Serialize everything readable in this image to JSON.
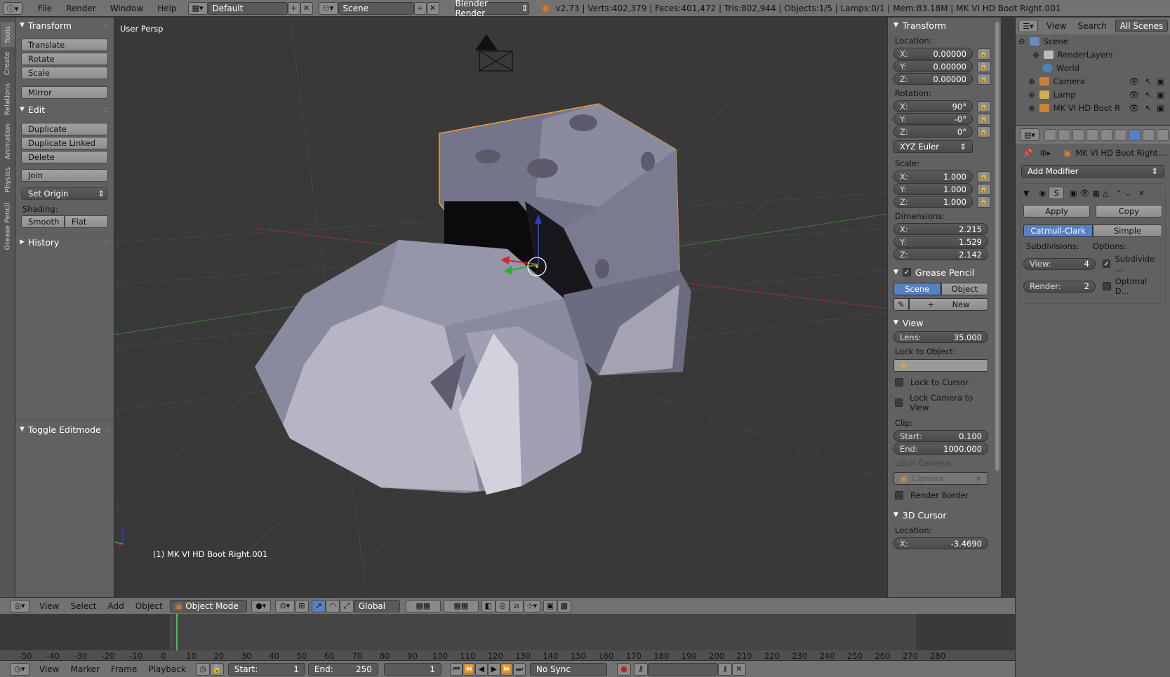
{
  "topbar": {
    "menus": [
      "File",
      "Render",
      "Window",
      "Help"
    ],
    "layout": "Default",
    "scene": "Scene",
    "engine": "Blender Render",
    "status": "v2.73 | Verts:402,379 | Faces:401,472 | Tris:802,944 | Objects:1/5 | Lamps:0/1 | Mem:83.18M | MK VI HD Boot Right.001"
  },
  "tabs": [
    "Tools",
    "Create",
    "Relations",
    "Animation",
    "Physics",
    "Grease Pencil"
  ],
  "toolshelf": {
    "transform_title": "Transform",
    "translate": "Translate",
    "rotate": "Rotate",
    "scale": "Scale",
    "mirror": "Mirror",
    "edit_title": "Edit",
    "duplicate": "Duplicate",
    "duplicate_linked": "Duplicate Linked",
    "delete": "Delete",
    "join": "Join",
    "set_origin": "Set Origin",
    "shading_label": "Shading:",
    "smooth": "Smooth",
    "flat": "Flat",
    "history_title": "History",
    "toggle_editmode_title": "Toggle Editmode"
  },
  "viewport": {
    "view_name": "User Persp",
    "object_label": "(1) MK VI HD Boot Right.001"
  },
  "npanel": {
    "transform_title": "Transform",
    "location_label": "Location:",
    "location": {
      "x": "0.00000",
      "y": "0.00000",
      "z": "0.00000"
    },
    "rotation_label": "Rotation:",
    "rotation": {
      "x": "90°",
      "y": "-0°",
      "z": "0°"
    },
    "rotation_mode": "XYZ Euler",
    "scale_label": "Scale:",
    "scale": {
      "x": "1.000",
      "y": "1.000",
      "z": "1.000"
    },
    "dimensions_label": "Dimensions:",
    "dimensions": {
      "x": "2.215",
      "y": "1.529",
      "z": "2.142"
    },
    "grease_title": "Grease Pencil",
    "grease_scene": "Scene",
    "grease_object": "Object",
    "grease_new": "New",
    "view_title": "View",
    "lens_label": "Lens:",
    "lens": "35.000",
    "lock_object_label": "Lock to Object:",
    "lock_cursor": "Lock to Cursor",
    "lock_camera": "Lock Camera to View",
    "clip_label": "Clip:",
    "clip_start_label": "Start:",
    "clip_start": "0.100",
    "clip_end_label": "End:",
    "clip_end": "1000.000",
    "local_camera_label": "Local Camera:",
    "local_camera": "Camera",
    "render_border": "Render Border",
    "cursor_title": "3D Cursor",
    "cursor_location_label": "Location:",
    "cursor_x": "-3.4690"
  },
  "outliner": {
    "header": {
      "view": "View",
      "search": "Search",
      "filter": "All Scenes"
    },
    "rows": [
      "Scene",
      "RenderLayers",
      "World",
      "Camera",
      "Lamp",
      "MK VI HD Boot R"
    ]
  },
  "properties": {
    "object_name": "MK VI HD Boot Right....",
    "add_modifier": "Add Modifier",
    "apply": "Apply",
    "copy": "Copy",
    "catmull": "Catmull-Clark",
    "simple": "Simple",
    "subdivisions_label": "Subdivisions:",
    "options_label": "Options:",
    "view_label": "View:",
    "view_value": "4",
    "render_label": "Render:",
    "render_value": "2",
    "subdivide_uvs": "Subdivide ...",
    "optimal_display": "Optimal D..."
  },
  "vp_header": {
    "menus": [
      "View",
      "Select",
      "Add",
      "Object"
    ],
    "mode": "Object Mode",
    "orientation": "Global"
  },
  "timeline": {
    "ticks": [
      "-50",
      "-40",
      "-30",
      "-20",
      "-10",
      "0",
      "10",
      "20",
      "30",
      "40",
      "50",
      "60",
      "70",
      "80",
      "90",
      "100",
      "110",
      "120",
      "130",
      "140",
      "150",
      "160",
      "170",
      "180",
      "190",
      "200",
      "210",
      "220",
      "230",
      "240",
      "250",
      "260",
      "270",
      "280"
    ],
    "menus": [
      "View",
      "Marker",
      "Frame",
      "Playback"
    ],
    "start_label": "Start:",
    "start": "1",
    "end_label": "End:",
    "end": "250",
    "current": "1",
    "sync": "No Sync"
  },
  "colors": {
    "accent": "#5680c2",
    "selection_outline": "#f0a030",
    "grid_red": "#b03030",
    "grid_green": "#409040"
  }
}
